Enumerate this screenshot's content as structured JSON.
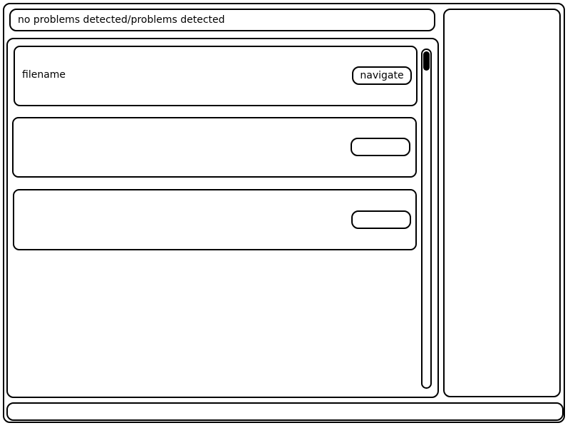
{
  "status": {
    "text": "no problems detected/problems detected"
  },
  "results": [
    {
      "filename": "filename",
      "button_label": "navigate"
    },
    {
      "filename": "",
      "button_label": ""
    },
    {
      "filename": "",
      "button_label": ""
    }
  ],
  "colors": {
    "border": "#000000",
    "background": "#ffffff"
  }
}
